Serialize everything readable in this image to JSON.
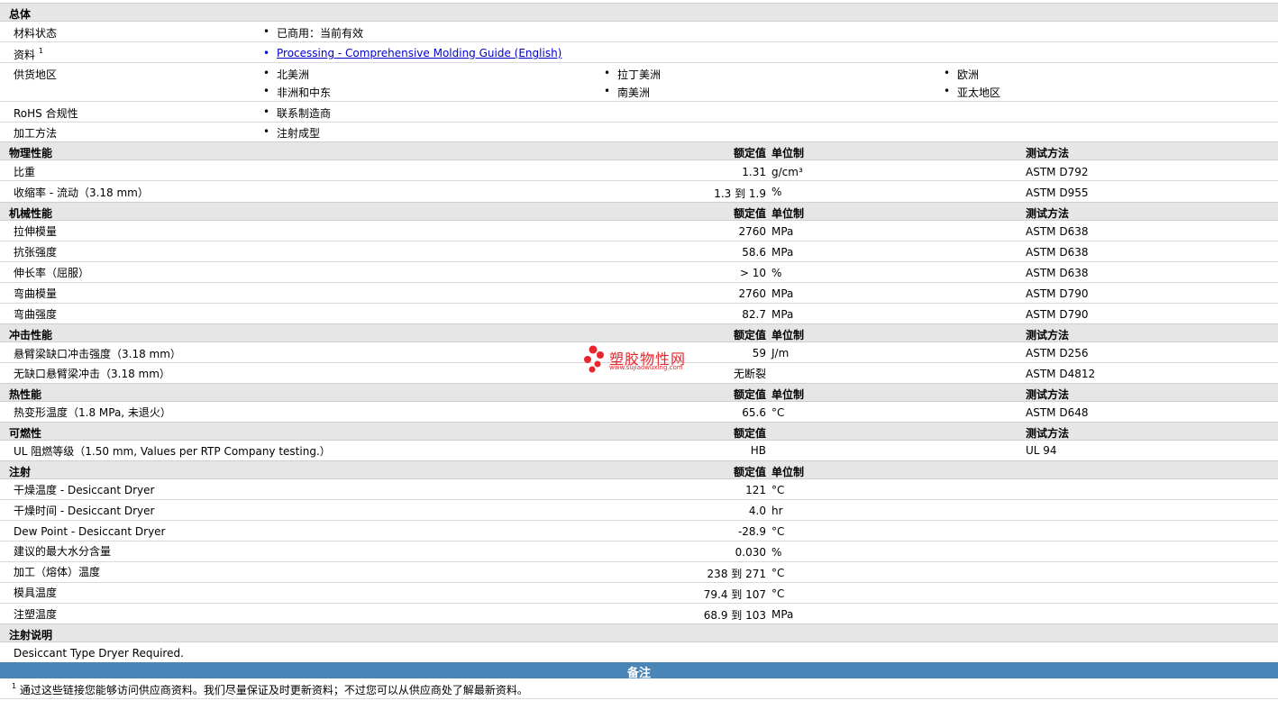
{
  "general": {
    "title": "总体",
    "status_label": "材料状态",
    "status_value": "已商用：当前有效",
    "docs_label": "资料",
    "docs_sup": "1",
    "docs_link": "Processing - Comprehensive Molding Guide (English)",
    "supply_label": "供货地区",
    "supply_regions": [
      "北美洲",
      "拉丁美洲",
      "欧洲",
      "非洲和中东",
      "南美洲",
      "亚太地区"
    ],
    "rohs_label": "RoHS 合规性",
    "rohs_value": "联系制造商",
    "method_label": "加工方法",
    "method_value": "注射成型"
  },
  "headers": {
    "value": "额定值",
    "unit": "单位制",
    "test": "测试方法"
  },
  "physical": {
    "title": "物理性能",
    "rows": [
      {
        "label": "比重",
        "value": "1.31",
        "unit": "g/cm³",
        "test": "ASTM D792"
      },
      {
        "label": "收缩率  - 流动（3.18 mm）",
        "value": "1.3 到  1.9",
        "unit": "%",
        "test": "ASTM D955"
      }
    ]
  },
  "mechanical": {
    "title": "机械性能",
    "rows": [
      {
        "label": "拉伸模量",
        "value": "2760",
        "unit": "MPa",
        "test": "ASTM D638"
      },
      {
        "label": "抗张强度",
        "value": "58.6",
        "unit": "MPa",
        "test": "ASTM D638"
      },
      {
        "label": "伸长率（屈服）",
        "value": "> 10",
        "unit": "%",
        "test": "ASTM D638"
      },
      {
        "label": "弯曲模量",
        "value": "2760",
        "unit": "MPa",
        "test": "ASTM D790"
      },
      {
        "label": "弯曲强度",
        "value": "82.7",
        "unit": "MPa",
        "test": "ASTM D790"
      }
    ]
  },
  "impact": {
    "title": "冲击性能",
    "rows": [
      {
        "label": "悬臂梁缺口冲击强度（3.18 mm）",
        "value": "59",
        "unit": "J/m",
        "test": "ASTM D256"
      },
      {
        "label": "无缺口悬臂梁冲击（3.18 mm）",
        "value": "无断裂",
        "unit": "",
        "test": "ASTM D4812"
      }
    ]
  },
  "thermal": {
    "title": "热性能",
    "rows": [
      {
        "label": "热变形温度（1.8 MPa, 未退火）",
        "value": "65.6",
        "unit": "°C",
        "test": "ASTM D648"
      }
    ]
  },
  "flammability": {
    "title": "可燃性",
    "rows": [
      {
        "label": "UL 阻燃等级（1.50 mm, Values per RTP Company testing.）",
        "value": "HB",
        "unit": "",
        "test": "UL 94"
      }
    ]
  },
  "injection": {
    "title": "注射",
    "rows": [
      {
        "label": "干燥温度  - Desiccant Dryer",
        "value": "121",
        "unit": "°C"
      },
      {
        "label": "干燥时间  - Desiccant Dryer",
        "value": "4.0",
        "unit": "hr"
      },
      {
        "label": "Dew Point - Desiccant Dryer",
        "value": "-28.9",
        "unit": "°C"
      },
      {
        "label": "建议的最大水分含量",
        "value": "0.030",
        "unit": "%"
      },
      {
        "label": "加工（熔体）温度",
        "value": "238 到  271",
        "unit": "°C"
      },
      {
        "label": "模具温度",
        "value": "79.4 到  107",
        "unit": "°C"
      },
      {
        "label": "注塑温度",
        "value": "68.9 到  103",
        "unit": "MPa"
      }
    ]
  },
  "injection_notes": {
    "title": "注射说明",
    "text": "Desiccant Type Dryer Required."
  },
  "notes": {
    "title": "备注",
    "sup": "1",
    "text": "通过这些链接您能够访问供应商资料。我们尽量保证及时更新资料；不过您可以从供应商处了解最新资料。"
  },
  "watermark": {
    "brand": "塑胶物性网",
    "url": "www.sujiaowuxing.com",
    "color": "#e8262d"
  },
  "colors": {
    "section_bg": "#e6e6e6",
    "note_header_bg": "#4a85b8",
    "link": "#0000cc"
  }
}
